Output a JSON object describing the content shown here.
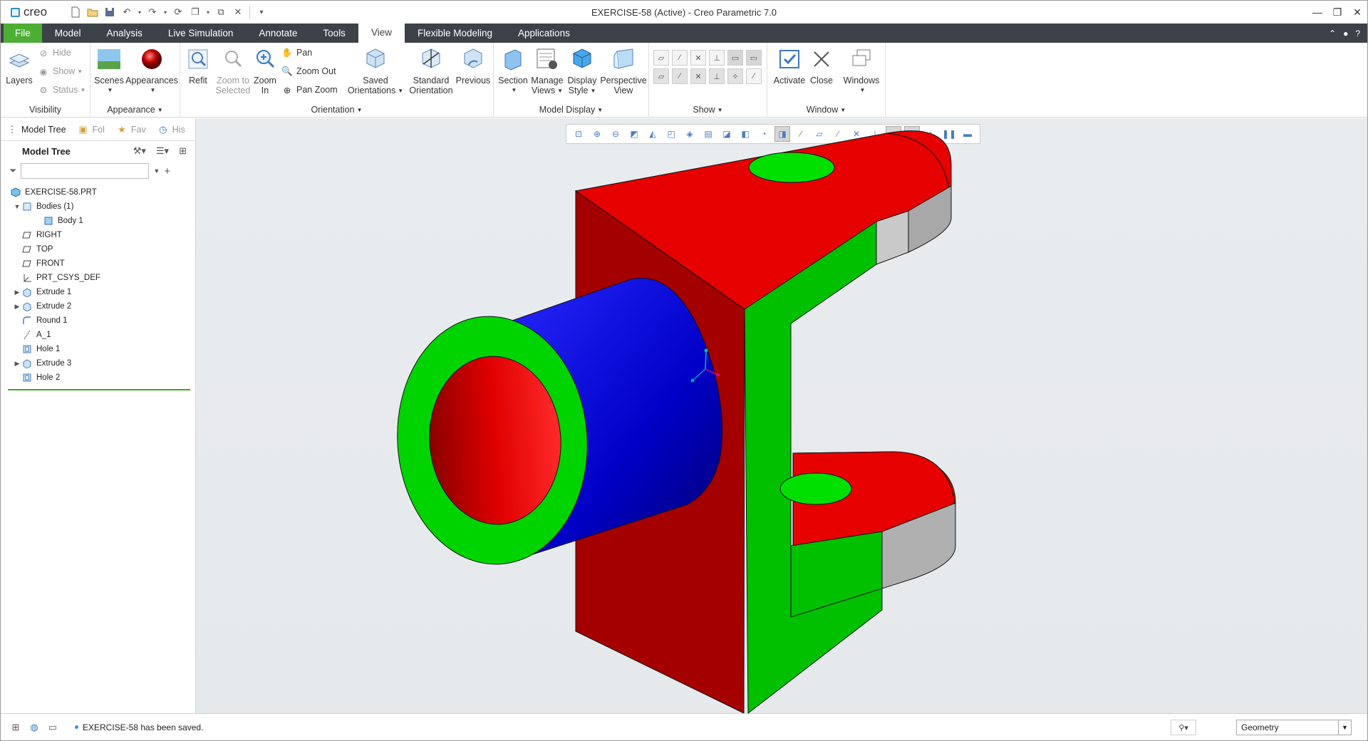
{
  "app": {
    "logo": "creo",
    "title": "EXERCISE-58 (Active) - Creo Parametric 7.0"
  },
  "tabs": [
    "File",
    "Model",
    "Analysis",
    "Live Simulation",
    "Annotate",
    "Tools",
    "View",
    "Flexible Modeling",
    "Applications"
  ],
  "active_tab": "View",
  "ribbon": {
    "visibility": {
      "layers": "Layers",
      "hide": "Hide",
      "show": "Show",
      "status": "Status",
      "label": "Visibility"
    },
    "appearance": {
      "scenes": "Scenes",
      "appearances": "Appearances",
      "label": "Appearance"
    },
    "orientation": {
      "refit": "Refit",
      "zoom_to_selected_1": "Zoom to",
      "zoom_to_selected_2": "Selected",
      "zoom_in_1": "Zoom",
      "zoom_in_2": "In",
      "pan": "Pan",
      "zoom_out": "Zoom Out",
      "pan_zoom": "Pan Zoom",
      "saved_1": "Saved",
      "saved_2": "Orientations",
      "standard_1": "Standard",
      "standard_2": "Orientation",
      "previous": "Previous",
      "label": "Orientation"
    },
    "model_display": {
      "section": "Section",
      "manage_1": "Manage",
      "manage_2": "Views",
      "display_1": "Display",
      "display_2": "Style",
      "perspective_1": "Perspective",
      "perspective_2": "View",
      "label": "Model Display"
    },
    "show": {
      "label": "Show"
    },
    "window": {
      "activate": "Activate",
      "close": "Close",
      "windows": "Windows",
      "label": "Window"
    }
  },
  "navigator": {
    "tabs": [
      "Model Tree",
      "Fol",
      "Fav",
      "His"
    ],
    "header": "Model Tree",
    "search_value": "",
    "tree": [
      {
        "label": "EXERCISE-58.PRT",
        "level": 0,
        "exp": "",
        "icon": "part-icon"
      },
      {
        "label": "Bodies (1)",
        "level": 1,
        "exp": "▼",
        "icon": "bodies-icon"
      },
      {
        "label": "Body 1",
        "level": 2,
        "exp": "",
        "icon": "body-icon"
      },
      {
        "label": "RIGHT",
        "level": 1,
        "exp": "",
        "icon": "datum-plane-icon"
      },
      {
        "label": "TOP",
        "level": 1,
        "exp": "",
        "icon": "datum-plane-icon"
      },
      {
        "label": "FRONT",
        "level": 1,
        "exp": "",
        "icon": "datum-plane-icon"
      },
      {
        "label": "PRT_CSYS_DEF",
        "level": 1,
        "exp": "",
        "icon": "csys-icon"
      },
      {
        "label": "Extrude 1",
        "level": 1,
        "exp": "▶",
        "icon": "extrude-icon"
      },
      {
        "label": "Extrude 2",
        "level": 1,
        "exp": "▶",
        "icon": "extrude-icon"
      },
      {
        "label": "Round 1",
        "level": 1,
        "exp": "",
        "icon": "round-icon"
      },
      {
        "label": "A_1",
        "level": 1,
        "exp": "",
        "icon": "axis-icon"
      },
      {
        "label": "Hole 1",
        "level": 1,
        "exp": "",
        "icon": "hole-icon"
      },
      {
        "label": "Extrude 3",
        "level": 1,
        "exp": "▶",
        "icon": "extrude-icon"
      },
      {
        "label": "Hole 2",
        "level": 1,
        "exp": "",
        "icon": "hole-icon"
      }
    ]
  },
  "status": {
    "message": "EXERCISE-58 has been saved.",
    "filter": "Geometry"
  },
  "colors": {
    "tab_bar": "#3d4248",
    "file_tab": "#4caf33",
    "face_red": "#e80000",
    "face_green": "#00cc00",
    "face_blue": "#0000d8",
    "face_gray": "#aaaaaa"
  }
}
